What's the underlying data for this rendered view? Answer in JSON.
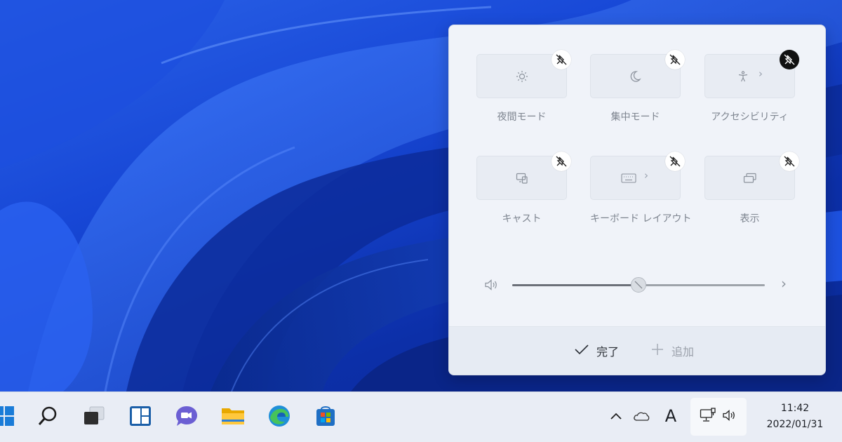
{
  "quick_settings": {
    "tiles": [
      {
        "label": "夜間モード",
        "icon": "brightness-icon",
        "has_chevron": false
      },
      {
        "label": "集中モード",
        "icon": "moon-icon",
        "has_chevron": false
      },
      {
        "label": "アクセシビリティ",
        "icon": "accessibility-icon",
        "has_chevron": true
      },
      {
        "label": "キャスト",
        "icon": "cast-icon",
        "has_chevron": false
      },
      {
        "label": "キーボード レイアウト",
        "icon": "keyboard-icon",
        "has_chevron": true
      },
      {
        "label": "表示",
        "icon": "display-icon",
        "has_chevron": false
      }
    ],
    "chevron": "›",
    "volume": {
      "level_percent": 50
    },
    "footer": {
      "done_label": "完了",
      "add_label": "追加"
    }
  },
  "taskbar": {
    "apps": [
      "windows-start-icon",
      "search-icon",
      "task-view-icon",
      "widgets-icon",
      "teams-chat-icon",
      "file-explorer-icon",
      "edge-icon",
      "store-icon"
    ],
    "tray": {
      "language_indicator": "A"
    },
    "clock": {
      "time": "11:42",
      "date": "2022/01/31"
    }
  },
  "colors": {
    "accent": "#0067c0",
    "wallpaper": "#1747d6",
    "panel_bg": "#f0f3f9"
  }
}
